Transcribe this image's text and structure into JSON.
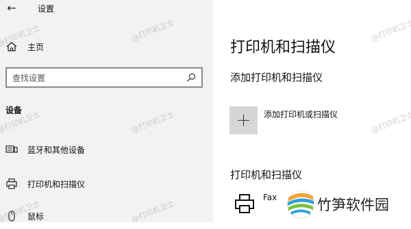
{
  "window": {
    "title": "设置",
    "back_icon": "back-arrow-icon"
  },
  "sidebar": {
    "home_label": "主页",
    "search": {
      "placeholder": "查找设置"
    },
    "section_header": "设备",
    "items": [
      {
        "label": "蓝牙和其他设备",
        "icon": "bluetooth-devices-icon"
      },
      {
        "label": "打印机和扫描仪",
        "icon": "printer-icon"
      },
      {
        "label": "鼠标",
        "icon": "mouse-icon"
      }
    ]
  },
  "main": {
    "title": "打印机和扫描仪",
    "add_section_title": "添加打印机和扫描仪",
    "add_label": "添加打印机或扫描仪",
    "list_section_title": "打印机和扫描仪",
    "printers": [
      {
        "name": "Fax"
      }
    ]
  },
  "watermark": {
    "text": "@打印机卫士"
  },
  "brand": {
    "name": "竹笋软件园"
  },
  "colors": {
    "sidebar_bg": "#f2f2f2",
    "add_button_bg": "#d6d6d6",
    "search_border": "#8a8a8a",
    "logo_orange": "#f0a43a",
    "logo_blue": "#2e9fd6",
    "logo_green": "#7bbf3a"
  }
}
